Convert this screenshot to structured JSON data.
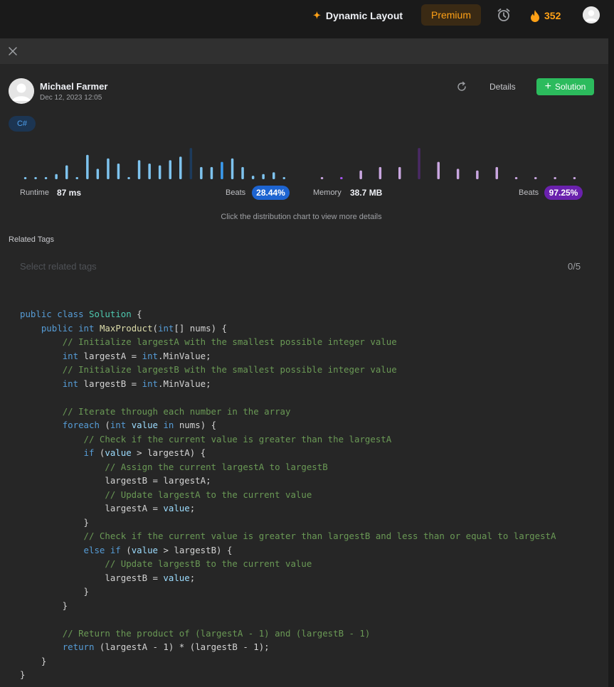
{
  "nav": {
    "dynamic_layout": "Dynamic Layout",
    "premium": "Premium",
    "streak": "352"
  },
  "submission": {
    "user_name": "Michael Farmer",
    "date": "Dec 12, 2023 12:05",
    "details_label": "Details",
    "solution_label": "Solution",
    "language": "C#"
  },
  "stats": {
    "runtime_label": "Runtime",
    "runtime_value": "87 ms",
    "runtime_beats_label": "Beats",
    "runtime_beats": "28.44%",
    "memory_label": "Memory",
    "memory_value": "38.7 MB",
    "memory_beats_label": "Beats",
    "memory_beats": "97.25%",
    "hint": "Click the distribution chart to view more details"
  },
  "chart_data": [
    {
      "type": "bar",
      "values": [
        2,
        2,
        2,
        6,
        16,
        2,
        28,
        12,
        24,
        18,
        2,
        22,
        18,
        16,
        22,
        26,
        36,
        14,
        14,
        20,
        24,
        14,
        4,
        6,
        8,
        2
      ],
      "highlight_index": 19,
      "color": "#7ec3ee",
      "highlight_color": "#3b9cf0",
      "max_color": "#1d3b5c"
    },
    {
      "type": "bar",
      "values": [
        2,
        2,
        10,
        14,
        14,
        36,
        20,
        12,
        10,
        14,
        2,
        2,
        2,
        2
      ],
      "highlight_index": 1,
      "color": "#c9a6e0",
      "highlight_color": "#a855f7",
      "max_color": "#4a2a66"
    }
  ],
  "tags": {
    "title": "Related Tags",
    "placeholder": "Select related tags",
    "count": "0/5"
  },
  "code": [
    "public class Solution {",
    "    public int MaxProduct(int[] nums) {",
    "        // Initialize largestA with the smallest possible integer value",
    "        int largestA = int.MinValue;",
    "        // Initialize largestB with the smallest possible integer value",
    "        int largestB = int.MinValue;",
    "",
    "        // Iterate through each number in the array",
    "        foreach (int value in nums) {",
    "            // Check if the current value is greater than the largestA",
    "            if (value > largestA) {",
    "                // Assign the current largestA to largestB",
    "                largestB = largestA;",
    "                // Update largestA to the current value",
    "                largestA = value;",
    "            }",
    "            // Check if the current value is greater than largestB and less than or equal to largestA",
    "            else if (value > largestB) {",
    "                // Update largestB to the current value",
    "                largestB = value;",
    "            }",
    "        }",
    "",
    "        // Return the product of (largestA - 1) and (largestB - 1)",
    "        return (largestA - 1) * (largestB - 1);",
    "    }",
    "}"
  ]
}
